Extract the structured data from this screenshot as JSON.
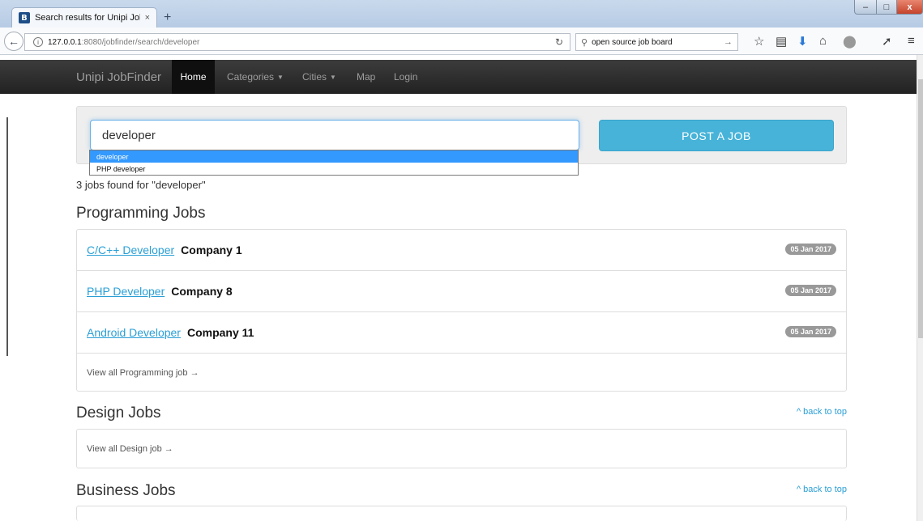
{
  "browser": {
    "tab_title": "Search results for Unipi Job...",
    "tab_favicon": "B",
    "tab_close": "×",
    "new_tab": "+",
    "url_host": "127.0.0.1",
    "url_rest": ":8080/jobfinder/search/developer",
    "search_text": "open source job board",
    "window_controls": {
      "minimize": "–",
      "maximize": "□",
      "close": "x"
    }
  },
  "nav": {
    "brand": "Unipi JobFinder",
    "items": [
      {
        "label": "Home"
      },
      {
        "label": "Categories"
      },
      {
        "label": "Cities"
      },
      {
        "label": "Map"
      },
      {
        "label": "Login"
      }
    ]
  },
  "search": {
    "query": "developer",
    "post_job_label": "POST A JOB",
    "suggestions": [
      "developer",
      "PHP developer"
    ],
    "results_text": "3 jobs found for \"developer\""
  },
  "sections": [
    {
      "title": "Programming Jobs",
      "jobs": [
        {
          "title": "C/C++ Developer",
          "company": "Company 1",
          "date": "05 Jan 2017"
        },
        {
          "title": "PHP Developer",
          "company": "Company 8",
          "date": "05 Jan 2017"
        },
        {
          "title": "Android Developer",
          "company": "Company 11",
          "date": "05 Jan 2017"
        }
      ],
      "view_all": "View all Programming job →"
    },
    {
      "title": "Design Jobs",
      "back_to_top": "^ back to top",
      "view_all": "View all Design job →"
    },
    {
      "title": "Business Jobs",
      "back_to_top": "^ back to top"
    }
  ],
  "colors": {
    "accent": "#2a9fd6",
    "post_button": "#47b3d9",
    "navbar": "#222222"
  }
}
